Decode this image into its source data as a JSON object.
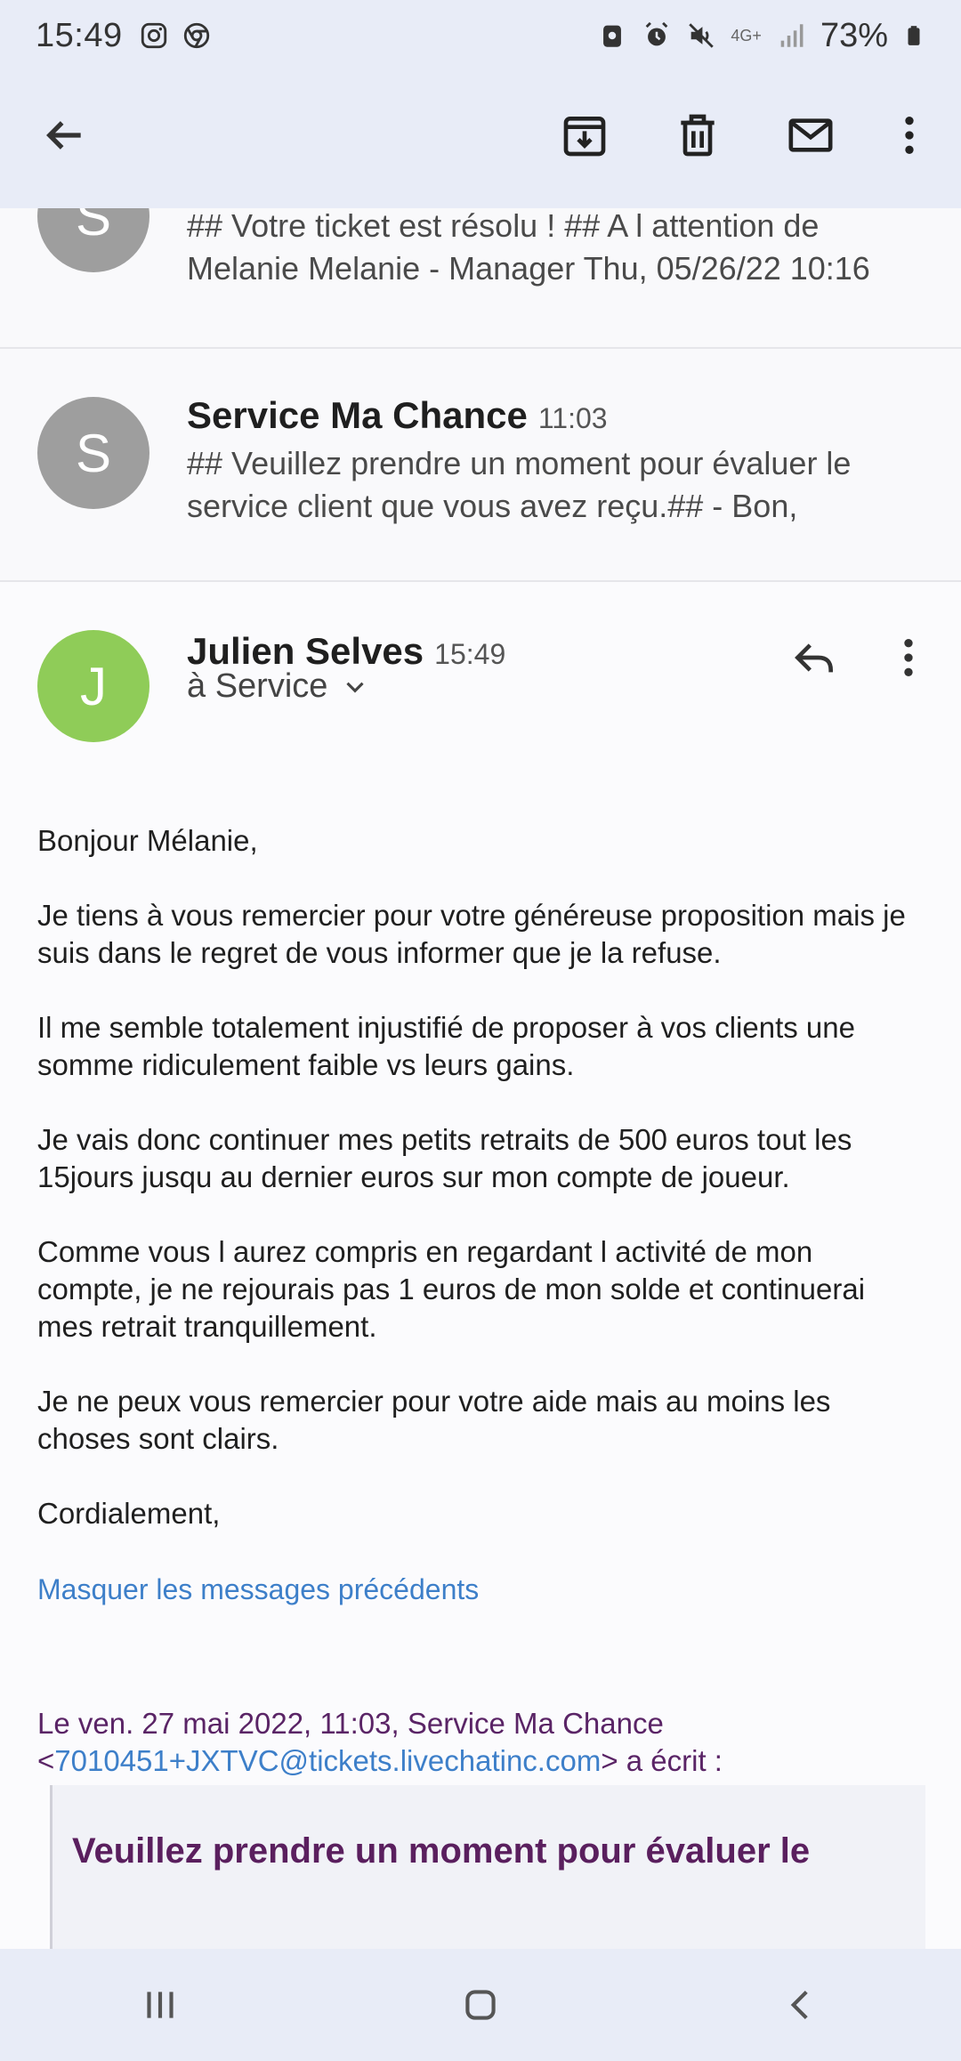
{
  "status_bar": {
    "time": "15:49",
    "battery": "73%",
    "network": "4G+"
  },
  "app_bar": {
    "icons": [
      "back-arrow-icon",
      "archive-icon",
      "delete-icon",
      "mark-unread-icon",
      "more-vert-icon"
    ]
  },
  "thread": {
    "collapsed": [
      {
        "avatar_letter": "S",
        "snippet": "## Votre ticket est résolu ! ## A l attention de Melanie Melanie - Manager Thu, 05/26/22 10:16"
      },
      {
        "avatar_letter": "S",
        "sender": "Service Ma Chance",
        "time": "11:03",
        "snippet": "## Veuillez prendre un moment pour évaluer le service client que vous avez reçu.## - Bon,"
      }
    ],
    "open_message": {
      "avatar_letter": "J",
      "sender": "Julien Selves",
      "time": "15:49",
      "recipient": "à Service",
      "body": [
        "Bonjour Mélanie,",
        "Je tiens à vous remercier pour votre généreuse proposition mais je suis dans le regret de vous informer que je la refuse.",
        "Il me semble totalement injustifié de proposer à vos clients une somme ridiculement faible vs leurs gains.",
        "Je vais donc continuer mes petits retraits de 500 euros tout les 15jours jusqu au dernier euros sur mon compte de joueur.",
        "Comme vous l aurez compris en regardant l activité de mon compte, je ne rejourais pas 1 euros de mon solde et continuerai mes retrait tranquillement.",
        "Je ne peux vous remercier pour votre aide mais au moins les choses sont clairs.",
        "Cordialement,"
      ],
      "hide_previous": "Masquer les messages précédents",
      "quote_header_prefix": "Le ven. 27 mai 2022, 11:03, Service Ma Chance",
      "quote_email_open": "<",
      "quote_email": "7010451+JXTVC@tickets.livechatinc.com",
      "quote_email_close": ">",
      "quote_suffix": " a écrit :",
      "quote_title": "Veuillez prendre un moment pour évaluer le"
    }
  },
  "colors": {
    "header_bg": "#e8ecf7",
    "avatar_grey": "#9e9e9e",
    "avatar_green": "#8fcc58",
    "link": "#3d7fc9",
    "quote_text": "#5a2466"
  }
}
